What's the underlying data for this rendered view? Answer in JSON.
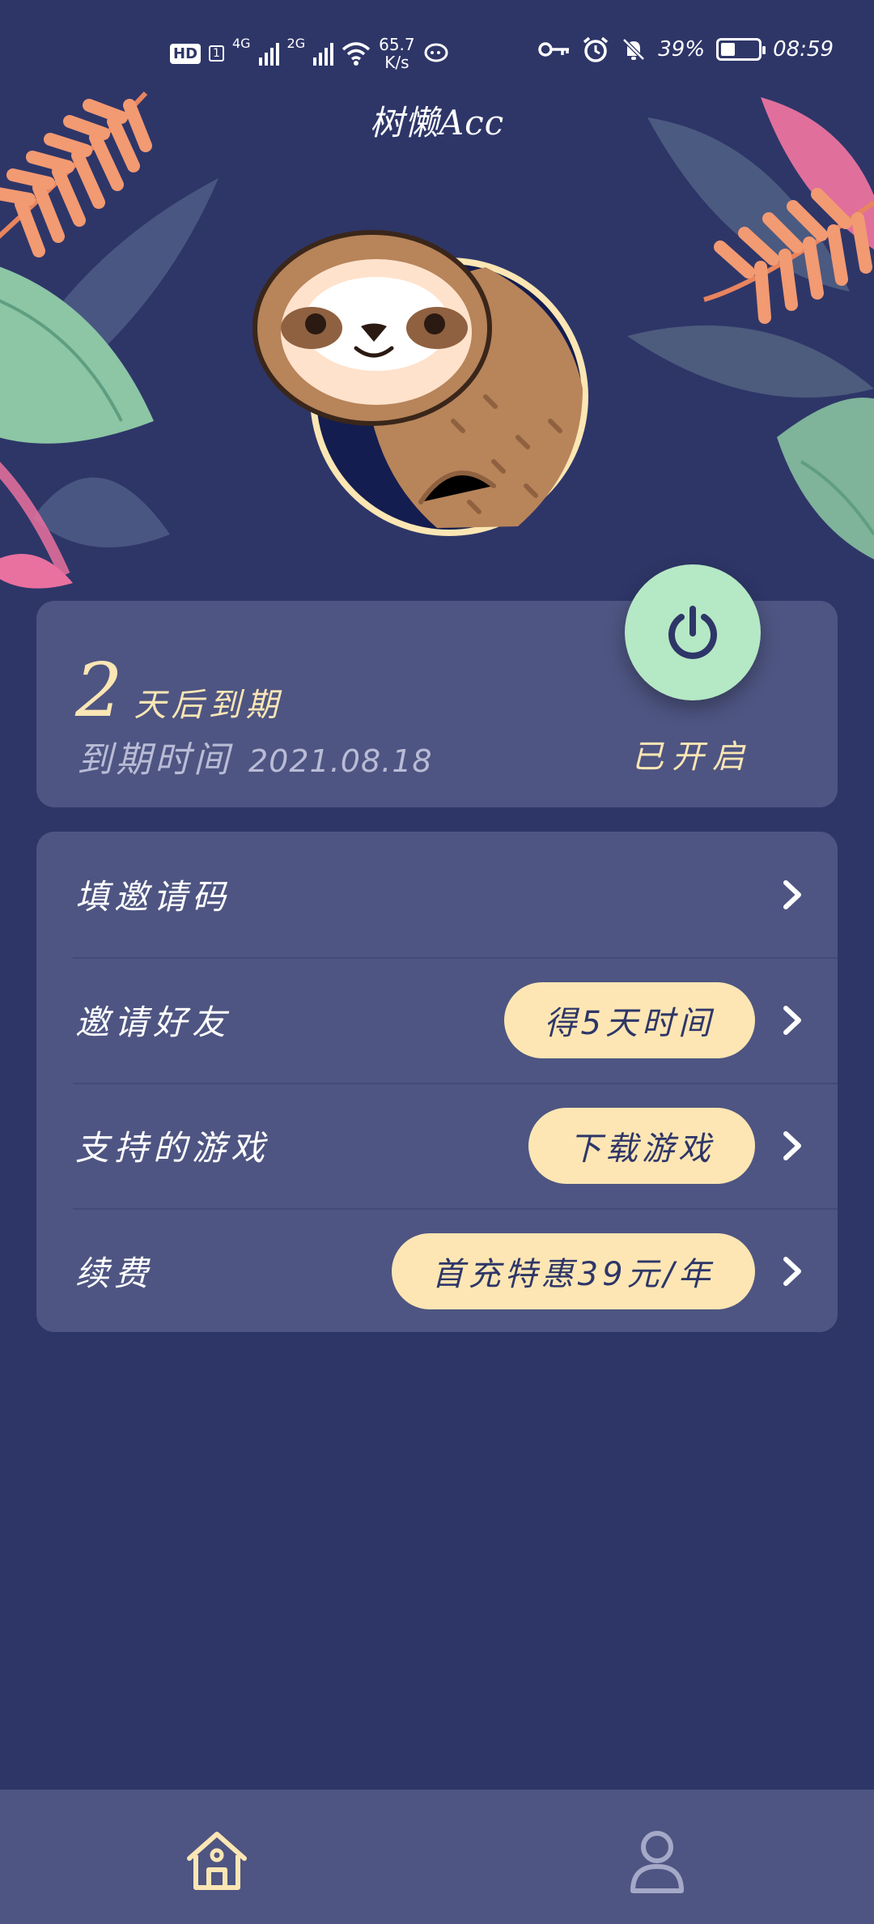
{
  "status_bar": {
    "hd": "HD",
    "sim": "1",
    "net1": "4G",
    "net2": "2G",
    "speed_value": "65.7",
    "speed_unit": "K/s",
    "battery_pct": "39%",
    "time": "08:59"
  },
  "app": {
    "title": "树懒Acc"
  },
  "status_card": {
    "days_number": "2",
    "days_text": "天后到期",
    "expiry_label": "到期时间",
    "expiry_date": "2021.08.18",
    "power_state": "已开启"
  },
  "menu": {
    "items": [
      {
        "label": "填邀请码",
        "pill": ""
      },
      {
        "label": "邀请好友",
        "pill": "得5天时间"
      },
      {
        "label": "支持的游戏",
        "pill": "下载游戏"
      },
      {
        "label": "续费",
        "pill": "首充特惠39元/年"
      }
    ]
  },
  "colors": {
    "background": "#2e3668",
    "card": "#4e5582",
    "accent": "#fde6b3",
    "power_button": "#b5e8c4"
  },
  "icons": {
    "power": "power-icon",
    "chevron": "chevron-right-icon",
    "home": "home-icon",
    "user": "user-icon"
  }
}
